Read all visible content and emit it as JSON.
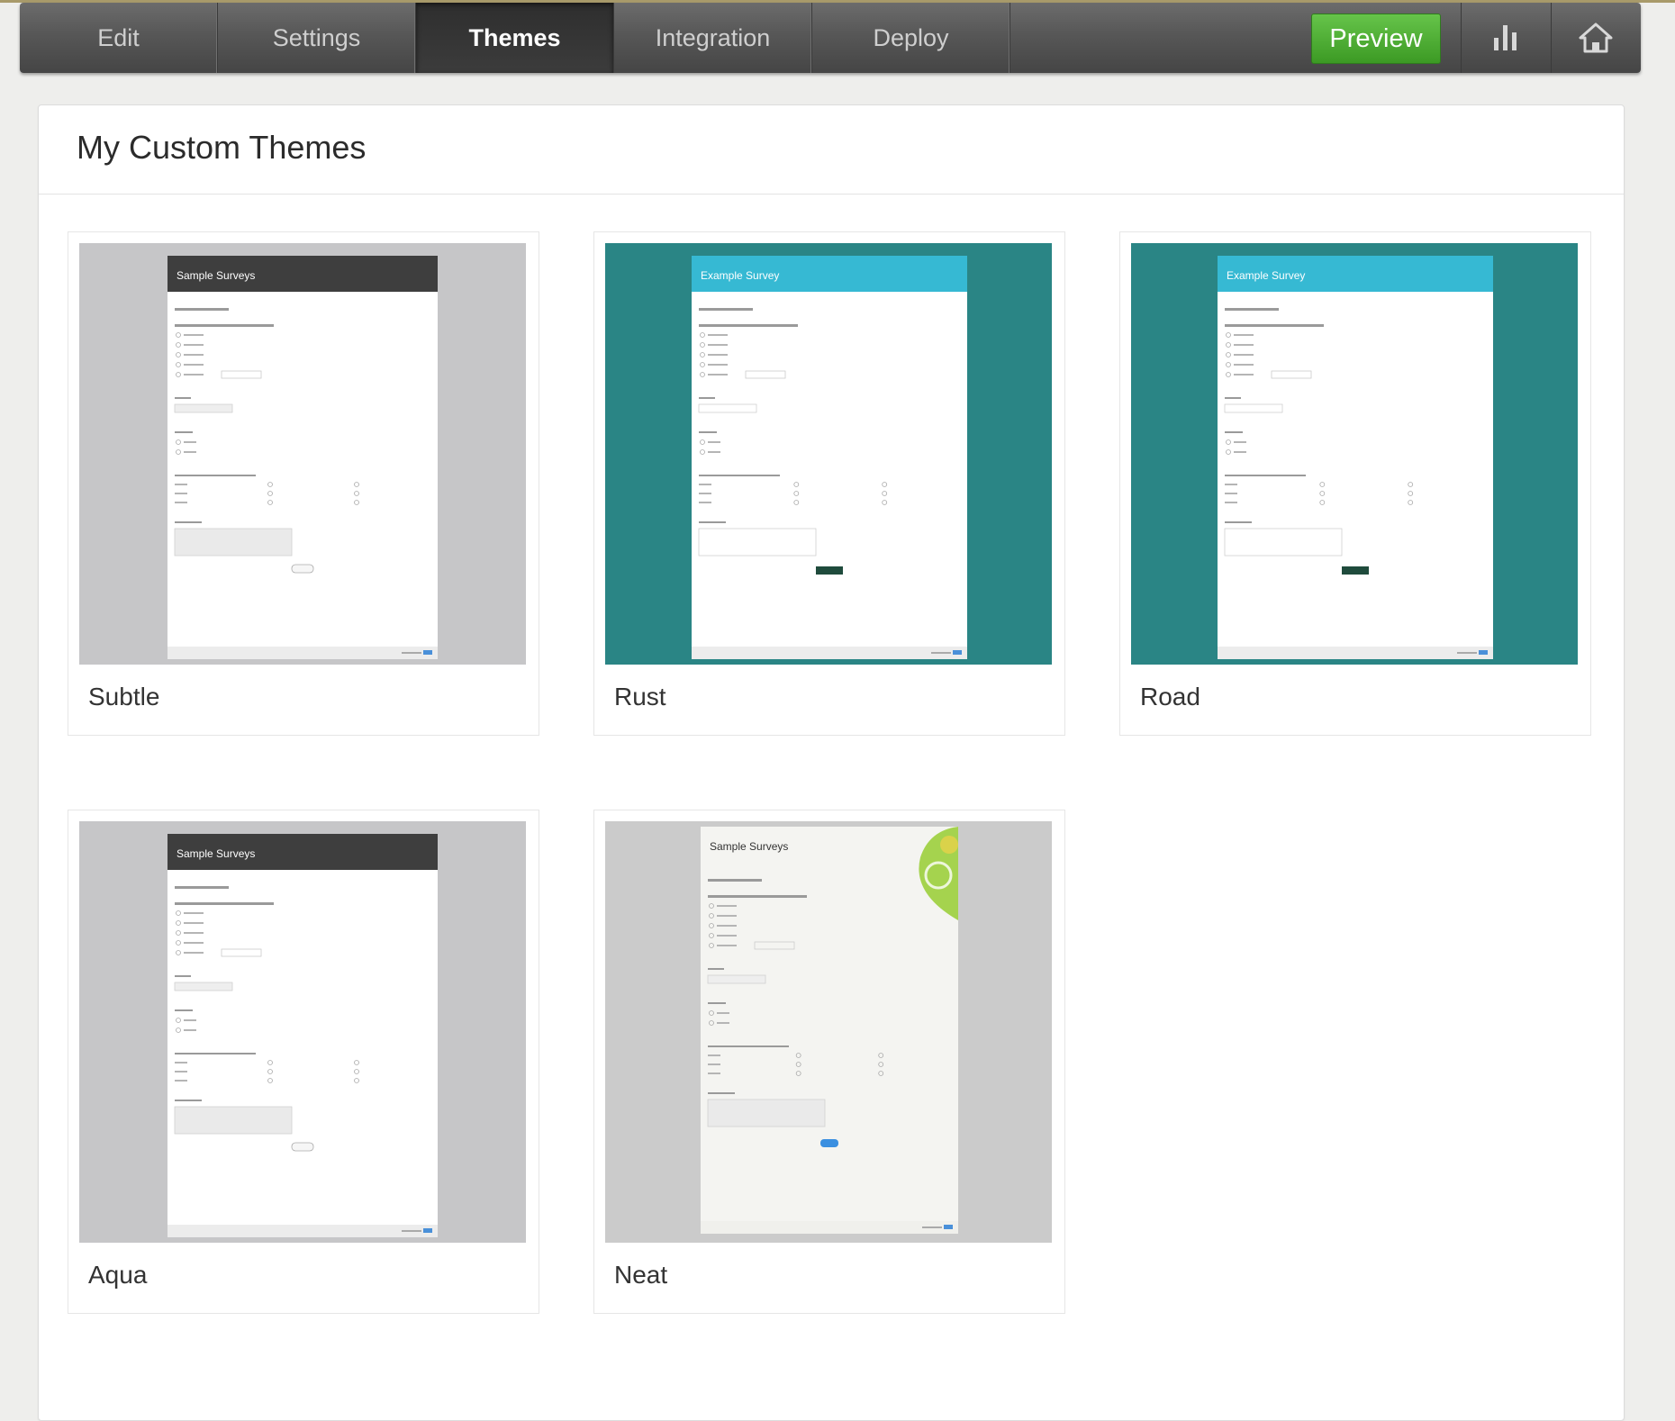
{
  "nav": {
    "tabs": [
      {
        "label": "Edit"
      },
      {
        "label": "Settings"
      },
      {
        "label": "Themes"
      },
      {
        "label": "Integration"
      },
      {
        "label": "Deploy"
      }
    ],
    "active_tab": "Themes",
    "preview_label": "Preview",
    "icons": [
      "bar-chart-icon",
      "home-icon"
    ]
  },
  "panel": {
    "title": "My Custom Themes"
  },
  "themes": [
    {
      "name": "Subtle",
      "preview_title": "Sample Surveys",
      "style": "dark-header",
      "bg": "#c6c6c8",
      "header": "#3e3e3e"
    },
    {
      "name": "Rust",
      "preview_title": "Example Survey",
      "style": "teal",
      "bg": "#2a8585",
      "header": "#36b9d3"
    },
    {
      "name": "Road",
      "preview_title": "Example Survey",
      "style": "teal",
      "bg": "#2a8585",
      "header": "#36b9d3"
    },
    {
      "name": "Aqua",
      "preview_title": "Sample Surveys",
      "style": "dark-header",
      "bg": "#c6c6c8",
      "header": "#3e3e3e"
    },
    {
      "name": "Neat",
      "preview_title": "Sample Surveys",
      "style": "leaf",
      "bg": "#cbcbcb",
      "header": "#f5f5f2"
    }
  ],
  "colors": {
    "preview_green": "#4caf34",
    "nav_bg": "#555555"
  }
}
